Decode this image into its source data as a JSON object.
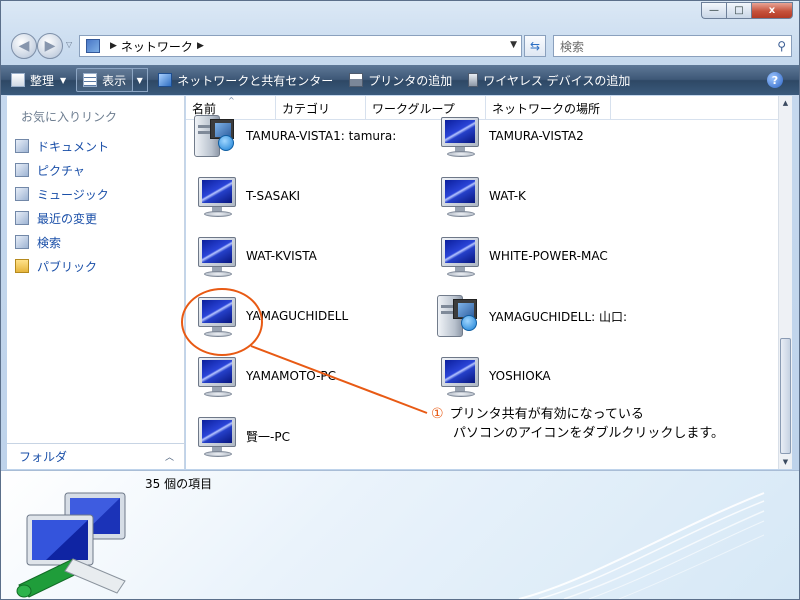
{
  "window": {
    "minimize_glyph": "—",
    "maximize_glyph": "□",
    "close_glyph": "x"
  },
  "nav": {
    "back_glyph": "◀",
    "forward_glyph": "▶",
    "address_path": "ネットワーク",
    "search_placeholder": "検索"
  },
  "toolbar": {
    "organize": "整理",
    "view": "表示",
    "network_center": "ネットワークと共有センター",
    "add_printer": "プリンタの追加",
    "add_wireless": "ワイヤレス デバイスの追加",
    "help": "?"
  },
  "sidebar": {
    "header": "お気に入りリンク",
    "items": [
      {
        "label": "ドキュメント",
        "icon": "documents-icon"
      },
      {
        "label": "ピクチャ",
        "icon": "pictures-icon"
      },
      {
        "label": "ミュージック",
        "icon": "music-icon"
      },
      {
        "label": "最近の変更",
        "icon": "recent-changes-icon"
      },
      {
        "label": "検索",
        "icon": "search-folder-icon"
      },
      {
        "label": "パブリック",
        "icon": "public-folder-icon"
      }
    ],
    "folders": "フォルダ"
  },
  "columns": [
    "名前",
    "カテゴリ",
    "ワークグループ",
    "ネットワークの場所"
  ],
  "items": [
    {
      "name": "TAMURA-VISTA1: tamura:",
      "type": "share"
    },
    {
      "name": "TAMURA-VISTA2",
      "type": "computer"
    },
    {
      "name": "T-SASAKI",
      "type": "computer"
    },
    {
      "name": "WAT-K",
      "type": "computer"
    },
    {
      "name": "WAT-KVISTA",
      "type": "computer"
    },
    {
      "name": "WHITE-POWER-MAC",
      "type": "computer"
    },
    {
      "name": "YAMAGUCHIDELL",
      "type": "computer"
    },
    {
      "name": "YAMAGUCHIDELL: 山口:",
      "type": "share"
    },
    {
      "name": "YAMAMOTO-PC",
      "type": "computer"
    },
    {
      "name": "YOSHIOKA",
      "type": "computer"
    },
    {
      "name": "賢一-PC",
      "type": "computer"
    }
  ],
  "details": {
    "count": "35 個の項目"
  },
  "annotation": {
    "number": "①",
    "line1": "プリンタ共有が有効になっている",
    "line2": "パソコンのアイコンをダブルクリックします。",
    "color": "#e85a14"
  }
}
